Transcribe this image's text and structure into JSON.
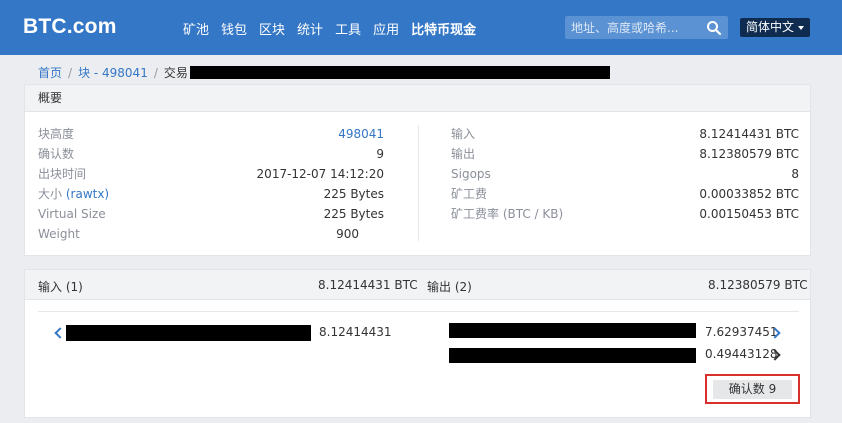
{
  "header": {
    "logo": "BTC.com",
    "nav": [
      "矿池",
      "钱包",
      "区块",
      "统计",
      "工具",
      "应用",
      "比特币现金"
    ],
    "search_placeholder": "地址、高度或哈希...",
    "language": "简体中文"
  },
  "breadcrumb": {
    "home": "首页",
    "block": "块 - 498041",
    "current": "交易"
  },
  "summary": {
    "title": "概要",
    "left": [
      {
        "label": "块高度",
        "value": "498041"
      },
      {
        "label": "确认数",
        "value": "9"
      },
      {
        "label": "出块时间",
        "value": "2017-12-07 14:12:20"
      },
      {
        "label": "大小",
        "label_link": "(rawtx)",
        "value": "225 Bytes"
      },
      {
        "label": "Virtual Size",
        "value": "225 Bytes"
      },
      {
        "label": "Weight",
        "value": "900"
      }
    ],
    "right": [
      {
        "label": "输入",
        "value": "8.12414431 BTC"
      },
      {
        "label": "输出",
        "value": "8.12380579 BTC"
      },
      {
        "label": "Sigops",
        "value": "8"
      },
      {
        "label": "矿工费",
        "value": "0.00033852 BTC"
      },
      {
        "label": "矿工费率 (BTC / KB)",
        "value": "0.00150453 BTC"
      }
    ]
  },
  "io": {
    "inputs_label": "输入 (1)",
    "inputs_total": "8.12414431 BTC",
    "outputs_label": "输出 (2)",
    "outputs_total": "8.12380579 BTC",
    "inputs": [
      {
        "amount": "8.12414431"
      }
    ],
    "outputs": [
      {
        "amount": "7.62937451"
      },
      {
        "amount": "0.49443128"
      }
    ],
    "confirmations": "确认数 9"
  },
  "colors": {
    "brand": "#3477c6",
    "lang_bg": "#0f2c50",
    "highlight": "#d9302c"
  }
}
